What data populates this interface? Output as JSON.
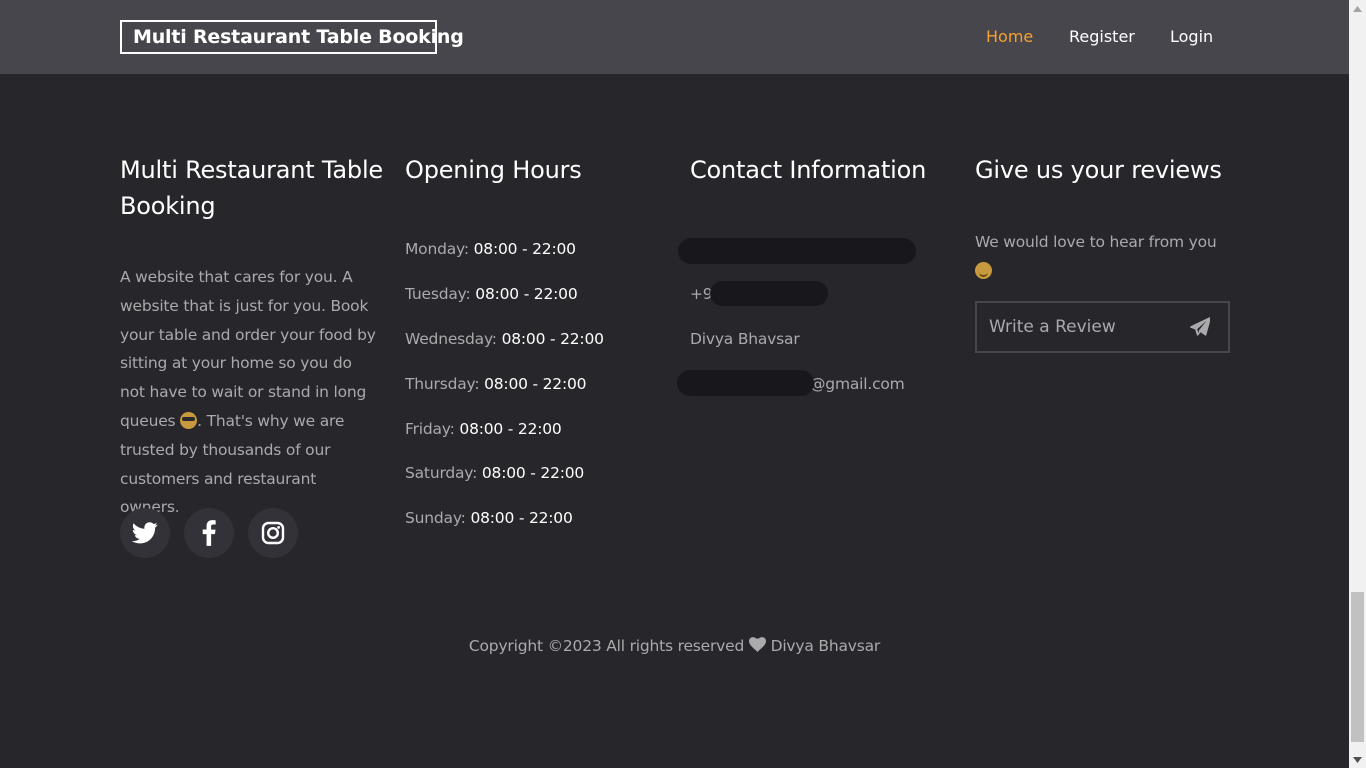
{
  "nav": {
    "brand": "Multi Restaurant Table Booking",
    "links": [
      "Home",
      "Register",
      "Login"
    ],
    "active_color": "#f7a22a"
  },
  "about": {
    "title": "Multi Restaurant Table Booking",
    "text_before_emoji": "A website that cares for you. A website that is just for you. Book your table and order your food by sitting at your home so you do not have to wait or stand in long queues ",
    "text_after_emoji": ". That's why we are trusted by thousands of our customers and restaurant owners.",
    "social": [
      "twitter-icon",
      "facebook-icon",
      "instagram-icon"
    ]
  },
  "hours": {
    "title": "Opening Hours",
    "rows": [
      {
        "day": "Monday:",
        "time": "08:00 - 22:00"
      },
      {
        "day": "Tuesday:",
        "time": "08:00 - 22:00"
      },
      {
        "day": "Wednesday:",
        "time": "08:00 - 22:00"
      },
      {
        "day": "Thursday:",
        "time": "08:00 - 22:00"
      },
      {
        "day": "Friday:",
        "time": "08:00 - 22:00"
      },
      {
        "day": "Saturday:",
        "time": "08:00 - 22:00"
      },
      {
        "day": "Sunday:",
        "time": "08:00 - 22:00"
      }
    ]
  },
  "contact": {
    "title": "Contact Information",
    "phone_prefix": "+91",
    "name": "Divya Bhavsar",
    "email_suffix": "@gmail.com"
  },
  "reviews": {
    "title": "Give us your reviews",
    "text": "We would love to hear from you",
    "placeholder": "Write a Review"
  },
  "copyright": {
    "before": "Copyright ©2023 All rights reserved",
    "after": "Divya Bhavsar"
  }
}
